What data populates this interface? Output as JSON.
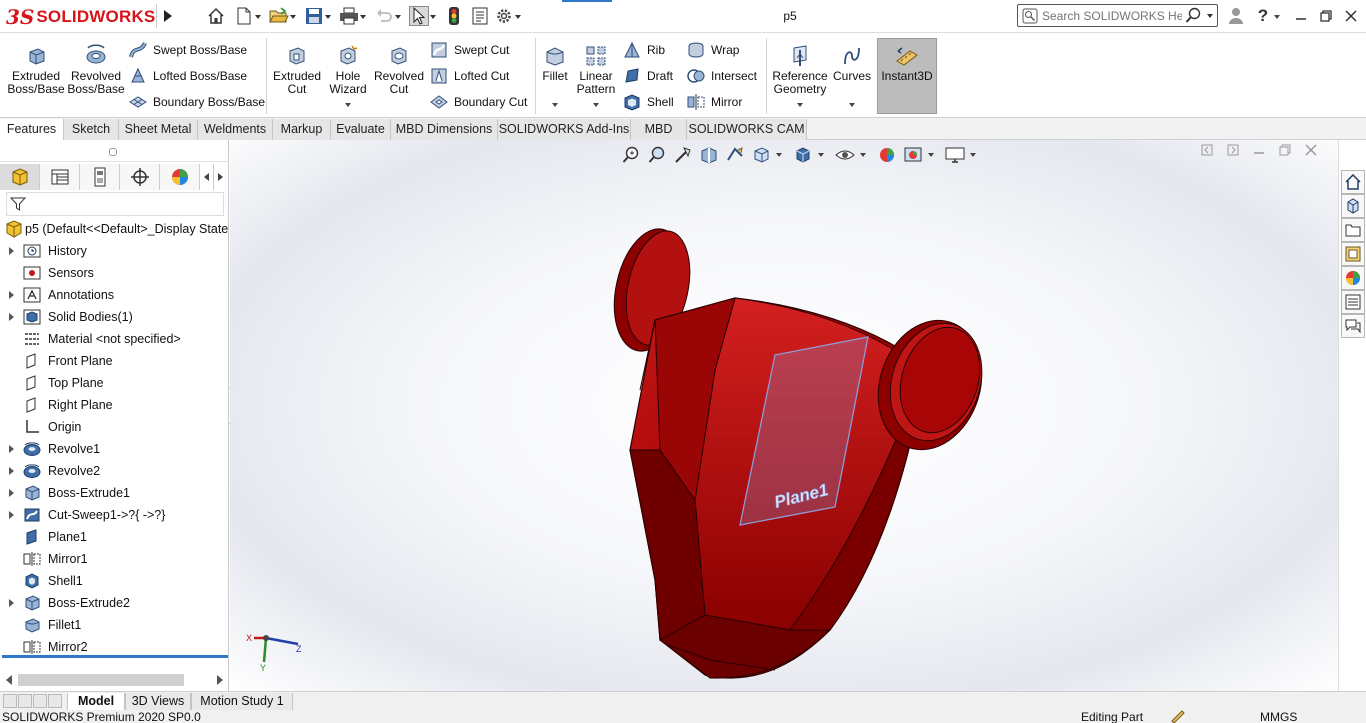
{
  "app": {
    "logo_text": "SOLIDWORKS",
    "document_title": "p5",
    "search_placeholder": "Search SOLIDWORKS Help",
    "help_label": "?"
  },
  "command_manager": {
    "extruded_boss": "Extruded Boss/Base",
    "revolved_boss": "Revolved Boss/Base",
    "swept_boss": "Swept Boss/Base",
    "lofted_boss": "Lofted Boss/Base",
    "boundary_boss": "Boundary Boss/Base",
    "extruded_cut": "Extruded Cut",
    "hole_wizard": "Hole Wizard",
    "revolved_cut": "Revolved Cut",
    "swept_cut": "Swept Cut",
    "lofted_cut": "Lofted Cut",
    "boundary_cut": "Boundary Cut",
    "fillet": "Fillet",
    "linear_pattern": "Linear Pattern",
    "rib": "Rib",
    "draft": "Draft",
    "shell": "Shell",
    "wrap": "Wrap",
    "intersect": "Intersect",
    "mirror": "Mirror",
    "reference_geometry": "Reference Geometry",
    "curves": "Curves",
    "instant3d": "Instant3D"
  },
  "tabs": [
    "Features",
    "Sketch",
    "Sheet Metal",
    "Weldments",
    "Markup",
    "Evaluate",
    "MBD Dimensions",
    "SOLIDWORKS Add-Ins",
    "MBD",
    "SOLIDWORKS CAM"
  ],
  "active_tab": "Features",
  "feature_tree": {
    "root": "p5  (Default<<Default>_Display State",
    "items": [
      {
        "label": "History",
        "icon": "history-icon",
        "expandable": true
      },
      {
        "label": "Sensors",
        "icon": "sensors-icon",
        "expandable": false
      },
      {
        "label": "Annotations",
        "icon": "annotations-icon",
        "expandable": true
      },
      {
        "label": "Solid Bodies(1)",
        "icon": "solid-bodies-icon",
        "expandable": true
      },
      {
        "label": "Material <not specified>",
        "icon": "material-icon",
        "expandable": false
      },
      {
        "label": "Front Plane",
        "icon": "plane-icon",
        "expandable": false
      },
      {
        "label": "Top Plane",
        "icon": "plane-icon",
        "expandable": false
      },
      {
        "label": "Right Plane",
        "icon": "plane-icon",
        "expandable": false
      },
      {
        "label": "Origin",
        "icon": "origin-icon",
        "expandable": false
      },
      {
        "label": "Revolve1",
        "icon": "revolve-icon",
        "expandable": true
      },
      {
        "label": "Revolve2",
        "icon": "revolve-icon",
        "expandable": true
      },
      {
        "label": "Boss-Extrude1",
        "icon": "extrude-icon",
        "expandable": true
      },
      {
        "label": "Cut-Sweep1->?{ ->?}",
        "icon": "cut-sweep-icon",
        "expandable": true
      },
      {
        "label": "Plane1",
        "icon": "ref-plane-icon",
        "expandable": false
      },
      {
        "label": "Mirror1",
        "icon": "mirror-icon",
        "expandable": false
      },
      {
        "label": "Shell1",
        "icon": "shell-icon",
        "expandable": false
      },
      {
        "label": "Boss-Extrude2",
        "icon": "extrude-icon",
        "expandable": true
      },
      {
        "label": "Fillet1",
        "icon": "fillet-icon",
        "expandable": false
      },
      {
        "label": "Mirror2",
        "icon": "mirror-icon",
        "expandable": false
      }
    ]
  },
  "viewport": {
    "plane_label": "Plane1",
    "triad": {
      "x": "X",
      "y": "Y",
      "z": "Z"
    },
    "part_color": "#a00000",
    "plane_color": "#8f9ad6"
  },
  "bottom_tabs": [
    "Model",
    "3D Views",
    "Motion Study 1"
  ],
  "active_bottom_tab": "Model",
  "status": {
    "version": "SOLIDWORKS Premium 2020 SP0.0",
    "mode": "Editing Part",
    "units": "MMGS"
  },
  "colors": {
    "accent": "#2e78c7",
    "brand_red": "#d7141a"
  }
}
